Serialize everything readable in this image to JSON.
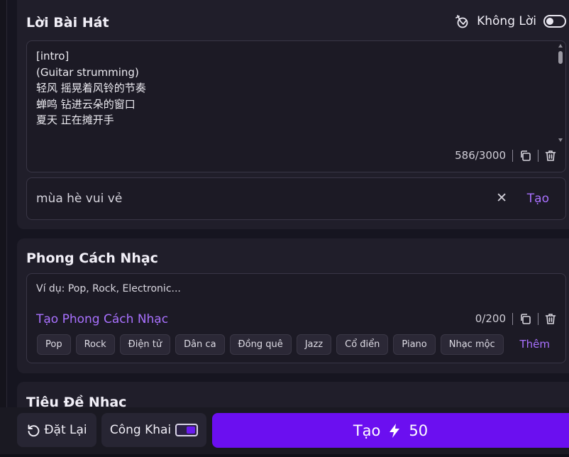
{
  "lyrics_section": {
    "title": "Lời Bài Hát",
    "instrumental_label": "Không Lời",
    "instrumental_on": false,
    "lyrics_text": "[intro]\n(Guitar strumming)\n轻风 摇晃着风铃的节奏\n蝉鸣 钻进云朵的窗口\n夏天 正在摊开手",
    "char_count": "586/3000",
    "prompt_value": "mùa hè vui vẻ",
    "generate_label": "Tạo"
  },
  "style_section": {
    "title": "Phong Cách Nhạc",
    "placeholder": "Ví dụ: Pop, Rock, Electronic...",
    "generate_style_label": "Tạo Phong Cách Nhạc",
    "char_count": "0/200",
    "chips": [
      "Pop",
      "Rock",
      "Điện tử",
      "Dân ca",
      "Đồng quê",
      "Jazz",
      "Cổ điển",
      "Piano",
      "Nhạc mộc"
    ],
    "more_label": "Thêm"
  },
  "title_section": {
    "title": "Tiêu Đề Nhạc"
  },
  "footer": {
    "reset_label": "Đặt Lại",
    "public_label": "Công Khai",
    "public_on": true,
    "create_label": "Tạo",
    "credits": "50"
  },
  "colors": {
    "accent": "#6b0ff0",
    "link": "#a971ff",
    "panel": "#201e2a",
    "background": "#161520"
  },
  "icons": [
    "instrumental-icon",
    "copy-icon",
    "trash-icon",
    "close-icon",
    "reset-icon",
    "bolt-icon"
  ]
}
